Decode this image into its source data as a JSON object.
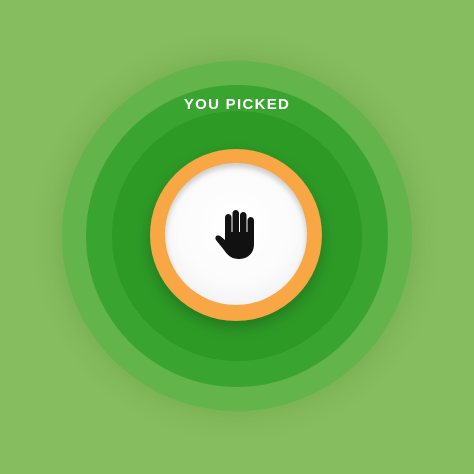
{
  "result": {
    "title": "YOU PICKED",
    "choice_icon": "raised-hand-icon"
  },
  "colors": {
    "background": "#86bd5e",
    "ring_outer": "#62b44b",
    "ring_mid": "#39a530",
    "ring_inner": "#2d9a26",
    "token_border": "#f9a644",
    "token_face": "#ffffff",
    "icon": "#111111",
    "title_text": "#ffffff"
  }
}
